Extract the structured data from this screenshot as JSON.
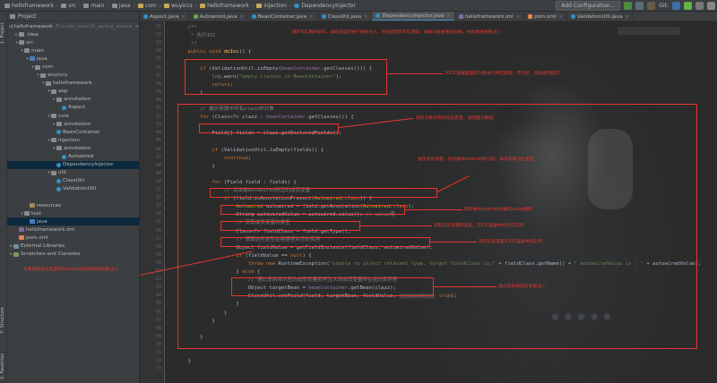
{
  "titlebar": {
    "breadcrumbs": [
      "helloframework",
      "src",
      "main",
      "java",
      "com",
      "wuyiccs",
      "helloframework",
      "injection",
      "DependencyInjector"
    ],
    "run_config": "Add Configuration...",
    "git_label": "Git:"
  },
  "project_panel": {
    "title": "Project",
    "tree": [
      {
        "label": "helloframework",
        "path": "D:\\code_learn\\0_spring_source_w",
        "indent": 0,
        "arrow": "▾",
        "icon": "folder"
      },
      {
        "label": ".idea",
        "indent": 1,
        "arrow": "▸",
        "icon": "folder"
      },
      {
        "label": "src",
        "indent": 1,
        "arrow": "▾",
        "icon": "folder"
      },
      {
        "label": "main",
        "indent": 2,
        "arrow": "▾",
        "icon": "folder"
      },
      {
        "label": "java",
        "indent": 3,
        "arrow": "▾",
        "icon": "src"
      },
      {
        "label": "com",
        "indent": 4,
        "arrow": "▾",
        "icon": "pkgf"
      },
      {
        "label": "wuyiccs",
        "indent": 5,
        "arrow": "▾",
        "icon": "pkgf"
      },
      {
        "label": "helloframework",
        "indent": 6,
        "arrow": "▾",
        "icon": "pkgf"
      },
      {
        "label": "aop",
        "indent": 7,
        "arrow": "▾",
        "icon": "pkgf"
      },
      {
        "label": "annotation",
        "indent": 8,
        "arrow": "▸",
        "icon": "pkgf"
      },
      {
        "label": "Aspect",
        "indent": 9,
        "arrow": "",
        "icon": "class"
      },
      {
        "label": "core",
        "indent": 7,
        "arrow": "▾",
        "icon": "pkgf"
      },
      {
        "label": "annotation",
        "indent": 8,
        "arrow": "▸",
        "icon": "pkgf"
      },
      {
        "label": "BeanContainer",
        "indent": 8,
        "arrow": "",
        "icon": "class"
      },
      {
        "label": "injection",
        "indent": 7,
        "arrow": "▾",
        "icon": "pkgf"
      },
      {
        "label": "annotation",
        "indent": 8,
        "arrow": "▾",
        "icon": "pkgf"
      },
      {
        "label": "Autowired",
        "indent": 9,
        "arrow": "",
        "icon": "class"
      },
      {
        "label": "DependencyInjector",
        "indent": 8,
        "arrow": "",
        "icon": "class",
        "selected": true
      },
      {
        "label": "util",
        "indent": 7,
        "arrow": "▾",
        "icon": "pkgf"
      },
      {
        "label": "ClassUtil",
        "indent": 8,
        "arrow": "",
        "icon": "class"
      },
      {
        "label": "ValidationUtil",
        "indent": 8,
        "arrow": "",
        "icon": "class"
      },
      {
        "label": "",
        "indent": 0,
        "arrow": "",
        "icon": "none"
      },
      {
        "label": "resources",
        "indent": 3,
        "arrow": "",
        "icon": "res"
      },
      {
        "label": "test",
        "indent": 2,
        "arrow": "▾",
        "icon": "folder"
      },
      {
        "label": "java",
        "indent": 3,
        "arrow": "",
        "icon": "src",
        "selected": true
      },
      {
        "label": "helloframework.iml",
        "indent": 1,
        "arrow": "",
        "icon": "iml"
      },
      {
        "label": "pom.xml",
        "indent": 1,
        "arrow": "",
        "icon": "xml"
      },
      {
        "label": "External Libraries",
        "indent": 0,
        "arrow": "▸",
        "icon": "lib"
      },
      {
        "label": "Scratches and Consoles",
        "indent": 0,
        "arrow": "▸",
        "icon": "scratch"
      }
    ]
  },
  "tool_strip": {
    "project": "1: Project",
    "structure": "7: Structure",
    "favorites": "2: Favorites"
  },
  "tabs": [
    {
      "label": "Aspect.java",
      "icon": "c"
    },
    {
      "label": "Autowired.java",
      "icon": "g"
    },
    {
      "label": "BeanContainer.java",
      "icon": "c"
    },
    {
      "label": "ClassUtil.java",
      "icon": "c"
    },
    {
      "label": "DependencyInjector.java",
      "icon": "c",
      "active": true
    },
    {
      "label": "helloframework.iml",
      "icon": "m"
    },
    {
      "label": "pom.xml",
      "icon": "x"
    },
    {
      "label": "ValidationUtil.java",
      "icon": "c"
    }
  ],
  "editor": {
    "code_lines": [
      {
        "n": "31",
        "html": "    <span class='cm'>/**</span>"
      },
      {
        "n": "32",
        "html": "    <span class='cm'> * 执行IOC</span>"
      },
      {
        "n": "33",
        "html": "    <span class='cm'> */</span>"
      },
      {
        "n": "34",
        "html": "    <span class='kw'>public void</span> <span class='fn'>doIoc</span>() {"
      },
      {
        "n": "35",
        "html": ""
      },
      {
        "n": "36",
        "html": "        <span class='kw'>if</span> (ValidationUtil.<i>isEmpty</i>(<span class='fld'>beanContainer</span>.getClasses())) {"
      },
      {
        "n": "37",
        "html": "            <span class='fld'>log</span>.warn(<span class='str'>\"empty classes in BeanContainer\"</span>);"
      },
      {
        "n": "38",
        "html": "            <span class='kw'>return</span>;"
      },
      {
        "n": "39",
        "html": "        }"
      },
      {
        "n": "40",
        "html": ""
      },
      {
        "n": "41",
        "html": "        <span class='cm'>// 遍历容器中所有class的对象</span>"
      },
      {
        "n": "42",
        "html": "        <span class='kw'>for</span> (Class&lt;?&gt; clazz : <span class='fld'>beanContainer</span>.getClasses()) {"
      },
      {
        "n": "43",
        "html": ""
      },
      {
        "n": "44",
        "html": "            Field[] fields = clazz.getDeclaredFields();"
      },
      {
        "n": "45",
        "html": ""
      },
      {
        "n": "46",
        "html": "            <span class='kw'>if</span> (ValidationUtil.<i>isEmpty</i>(fields)) {"
      },
      {
        "n": "47",
        "html": "                <span class='kw'>continue</span>;"
      },
      {
        "n": "48",
        "html": "            }"
      },
      {
        "n": "49",
        "html": ""
      },
      {
        "n": "50",
        "html": "            <span class='kw'>for</span> (Field field : fields) {"
      },
      {
        "n": "51",
        "html": "                <span class='cm'>// 找出被Autowired标记的成员变量</span>"
      },
      {
        "n": "52",
        "html": "                <span class='kw'>if</span> (field.isAnnotationPresent(<span class='an'>Autowired</span>.<span class='kw'>class</span>)) {"
      },
      {
        "n": "53",
        "html": "                    <span class='an'>Autowired</span> autowired = field.getAnnotation(<span class='an'>Autowired</span>.<span class='kw'>class</span>);"
      },
      {
        "n": "54",
        "html": "                    String autowiredValue = autowired.value(); <span class='cm'>// value值</span>"
      },
      {
        "n": "55",
        "html": "                    <span class='cm'>// 获取成员变量的类型</span>"
      },
      {
        "n": "56",
        "html": "                    Class&lt;?&gt; fieldClass = field.getType();"
      },
      {
        "n": "57",
        "html": "                    <span class='cm'>// 获取这些类型在容器里对应的实例</span>"
      },
      {
        "n": "58",
        "html": "                    Object fieldValue = getFieldInstance(fieldClass, autowiredValue);"
      },
      {
        "n": "59",
        "html": "                    <span class='kw'>if</span> (fieldValue == <span class='kw'>null</span>) {"
      },
      {
        "n": "60",
        "html": "                        <span class='kw'>throw new</span> RuntimeException(<span class='str'>\"unable to inject relevant type, target fieldClass is:\"</span> + fieldClass.getName() + <span class='str'>\" autowiredValue is : \"</span> + autowiredValue);"
      },
      {
        "n": "61",
        "html": "                    } <span class='kw'>else</span> {"
      },
      {
        "n": "62",
        "html": "                        <span class='cm'>// 通过反射将对应的成员变量实例注入到成员变量所在类的实例里</span>"
      },
      {
        "n": "63",
        "html": "                        Object targetBean = <span class='fld'>beanContainer</span>.getBean(clazz);"
      },
      {
        "n": "64",
        "html": "                        ClassUtil.<i>setField</i>(field, targetBean, fieldValue, <span class='hint'>accessible:</span> <span class='kw'>true</span>);"
      },
      {
        "n": "65",
        "html": "                    }"
      },
      {
        "n": "66",
        "html": "                }"
      },
      {
        "n": "67",
        "html": "            }"
      },
      {
        "n": "68",
        "html": ""
      },
      {
        "n": "69",
        "html": "        }"
      },
      {
        "n": "70",
        "html": ""
      },
      {
        "n": "71",
        "html": ""
      },
      {
        "n": "72",
        "html": "    }"
      },
      {
        "n": "73",
        "html": ""
      }
    ],
    "notes": {
      "top": "循环IOC相关操作，加载完成的进行依赖注入，开始处理的IOC逻辑：加载对象属性的依赖，将此属性依赖注入",
      "n1": "对IOC容器里面的对象进行判空处理，若为空，直接返回提示",
      "n2": "获取对象所有的成员变量，返回值为数组",
      "n3": "遍历成员变量，找到被Autowired标记的，再去获取对应类型",
      "n4": "获取被Autowired注解的value属性",
      "n5": "获取成员变量的类型，在IOC容器中找对应实例",
      "n6": "获取成员变量在IOC容器中的实例",
      "n7": "通过反射将成员变量注入",
      "left": "主要依赖成员变量的Autowired注解完成依赖注入"
    }
  }
}
